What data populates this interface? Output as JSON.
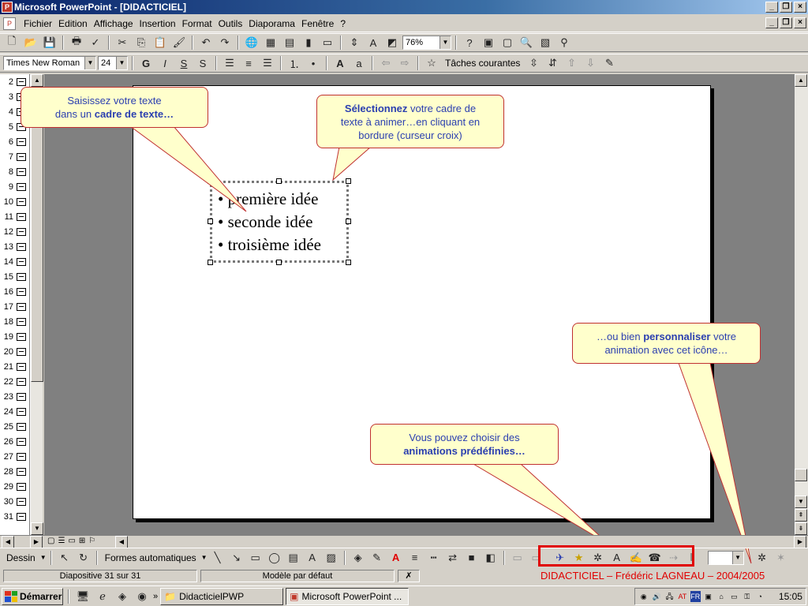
{
  "window": {
    "title": "Microsoft PowerPoint - [DIDACTICIEL]"
  },
  "menu": [
    "Fichier",
    "Edition",
    "Affichage",
    "Insertion",
    "Format",
    "Outils",
    "Diaporama",
    "Fenêtre",
    "?"
  ],
  "toolbar": {
    "zoom": "76%"
  },
  "format_bar": {
    "font": "Times New Roman",
    "size": "24",
    "tasks": "Tâches courantes"
  },
  "slide_numbers": [
    "2",
    "3",
    "4",
    "5",
    "6",
    "7",
    "8",
    "9",
    "10",
    "11",
    "12",
    "13",
    "14",
    "15",
    "16",
    "17",
    "18",
    "19",
    "20",
    "21",
    "22",
    "23",
    "24",
    "25",
    "26",
    "27",
    "28",
    "29",
    "30",
    "31"
  ],
  "slide": {
    "bullets": [
      "• première idée",
      "• seconde idée",
      "• troisième idée"
    ]
  },
  "callouts": {
    "c1": {
      "line1": "Saisissez votre texte",
      "line2a": "dans un ",
      "line2b": "cadre de texte…"
    },
    "c2": {
      "bold": "Sélectionnez",
      "l1": " votre cadre de",
      "l2": "texte à animer…en cliquant en",
      "l3": "bordure (curseur croix)"
    },
    "c3": {
      "l1a": "…ou bien ",
      "l1b": "personnaliser",
      "l1c": " votre",
      "l2": "animation avec cet icône…"
    },
    "c4": {
      "l1": "Vous pouvez choisir des",
      "l2": "animations prédéfinies…"
    }
  },
  "drawing": {
    "dessin": "Dessin",
    "formes": "Formes automatiques"
  },
  "status": {
    "slide": "Diapositive 31 sur 31",
    "model": "Modèle par défaut",
    "footer": "DIDACTICIEL – Frédéric LAGNEAU – 2004/2005"
  },
  "taskbar": {
    "start": "Démarrer",
    "task1": "DidacticielPWP",
    "task2": "Microsoft PowerPoint ...",
    "clock": "15:05",
    "lang": "FR"
  }
}
